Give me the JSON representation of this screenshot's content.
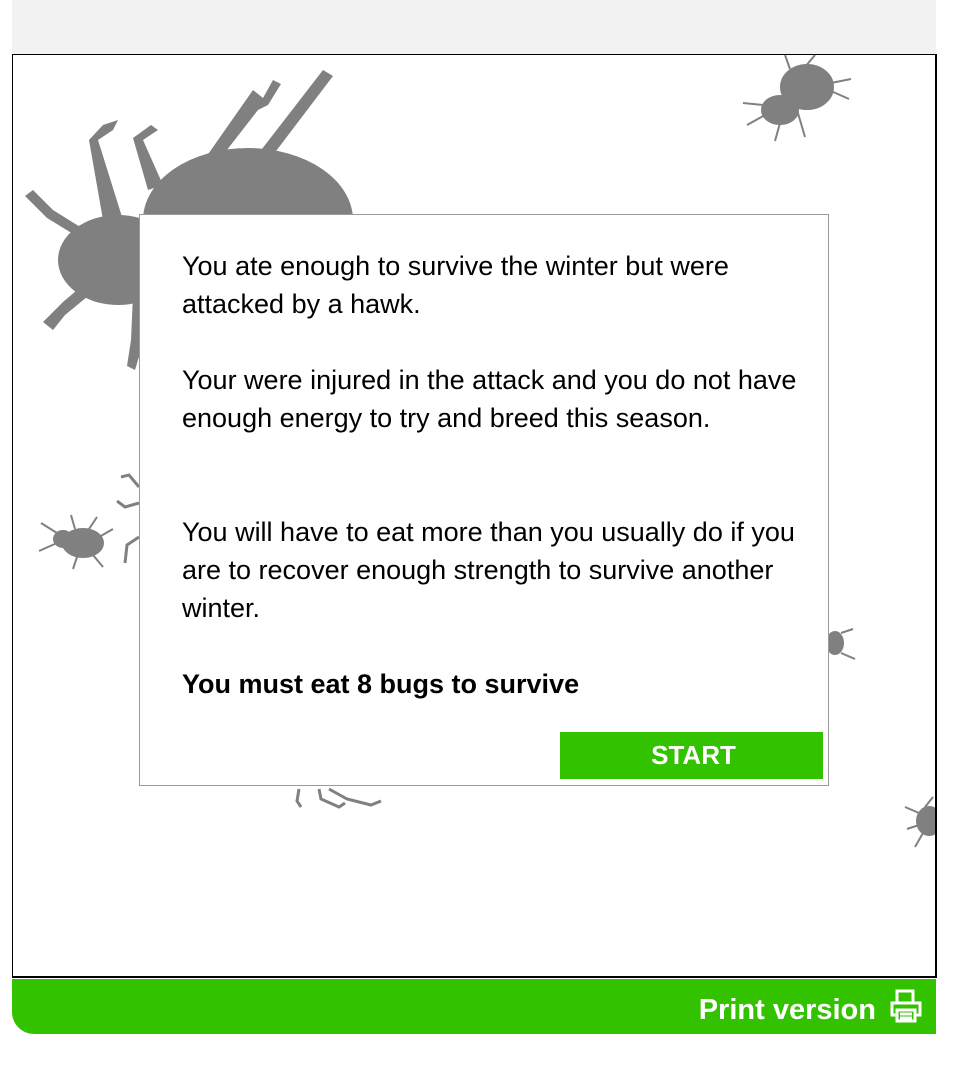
{
  "dialog": {
    "paragraph1": "You ate enough to survive the winter but were attacked by a hawk.",
    "paragraph2": "Your were injured in the attack and you do not have enough energy to try and breed this  season.",
    "paragraph3": "You will have to eat more than you usually do if you are to recover enough strength to survive another winter.",
    "goal": "You must eat 8 bugs to survive",
    "start_label": "START"
  },
  "footer": {
    "print_label": "Print version",
    "print_icon": "printer-icon"
  },
  "colors": {
    "accent_green": "#33c200",
    "bug_gray": "#808080"
  }
}
